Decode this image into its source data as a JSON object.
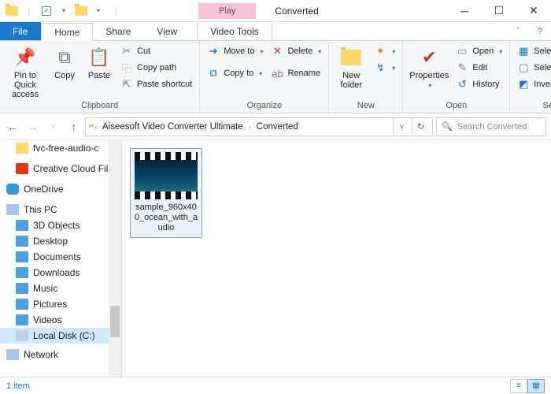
{
  "window": {
    "contextual_tab_title": "Play",
    "title": "Converted"
  },
  "tabs": {
    "file": "File",
    "home": "Home",
    "share": "Share",
    "view": "View",
    "video_tools": "Video Tools"
  },
  "ribbon": {
    "clipboard": {
      "label": "Clipboard",
      "pin": "Pin to Quick access",
      "copy": "Copy",
      "paste": "Paste",
      "cut": "Cut",
      "copy_path": "Copy path",
      "paste_shortcut": "Paste shortcut"
    },
    "organize": {
      "label": "Organize",
      "move_to": "Move to",
      "copy_to": "Copy to",
      "delete": "Delete",
      "rename": "Rename"
    },
    "new": {
      "label": "New",
      "new_folder": "New folder"
    },
    "open": {
      "label": "Open",
      "properties": "Properties",
      "open": "Open",
      "edit": "Edit",
      "history": "History"
    },
    "select": {
      "label": "Select",
      "select_all": "Select all",
      "select_none": "Select none",
      "invert": "Invert selection"
    }
  },
  "address": {
    "seg1": "Aiseesoft Video Converter Ultimate",
    "seg2": "Converted"
  },
  "search": {
    "placeholder": "Search Converted"
  },
  "tree": {
    "fvc": "fvc-free-audio-c",
    "cc": "Creative Cloud Fil",
    "onedrive": "OneDrive",
    "thispc": "This PC",
    "objects3d": "3D Objects",
    "desktop": "Desktop",
    "documents": "Documents",
    "downloads": "Downloads",
    "music": "Music",
    "pictures": "Pictures",
    "videos": "Videos",
    "localdisk": "Local Disk (C:)",
    "network": "Network"
  },
  "file": {
    "name": "sample_960x400_ocean_with_audio"
  },
  "status": {
    "count": "1 item"
  }
}
